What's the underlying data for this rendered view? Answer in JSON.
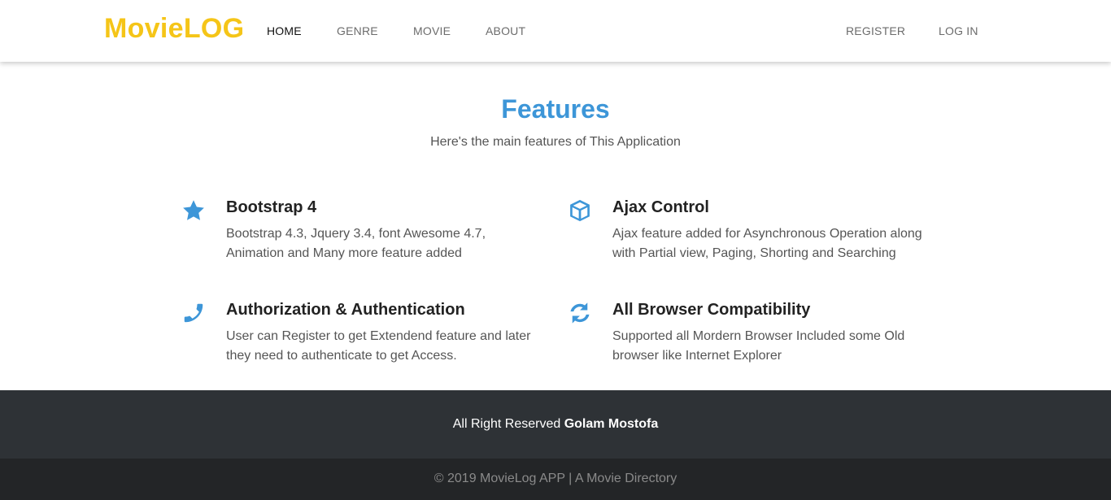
{
  "navbar": {
    "brand": "MovieLOG",
    "left_links": [
      {
        "label": "HOME"
      },
      {
        "label": "GENRE"
      },
      {
        "label": "MOVIE"
      },
      {
        "label": "ABOUT"
      }
    ],
    "right_links": [
      {
        "label": "REGISTER"
      },
      {
        "label": "LOG IN"
      }
    ],
    "active": "HOME"
  },
  "features": {
    "title": "Features",
    "subtitle": "Here's the main features of This Application",
    "items": [
      {
        "icon": "star-icon",
        "title": "Bootstrap 4",
        "text": "Bootstrap 4.3, Jquery 3.4, font Awesome 4.7, Animation and Many more feature added"
      },
      {
        "icon": "cube-icon",
        "title": "Ajax Control",
        "text": "Ajax feature added for Asynchronous Operation along with Partial view, Paging, Shorting and Searching"
      },
      {
        "icon": "phone-icon",
        "title": "Authorization & Authentication",
        "text": "User can Register to get Extendend feature and later they need to authenticate to get Access."
      },
      {
        "icon": "refresh-icon",
        "title": "All Browser Compatibility",
        "text": "Supported all Mordern Browser Included some Old browser like Internet Explorer"
      }
    ]
  },
  "footer": {
    "credit_prefix": "All Right Reserved",
    "credit_name": "Golam Mostofa",
    "copyright": "© 2019 MovieLog APP | A Movie Directory"
  },
  "colors": {
    "brand": "#f5c518",
    "accent": "#3d96d8",
    "footer_top": "#2e3236",
    "footer_bottom": "#232527"
  }
}
